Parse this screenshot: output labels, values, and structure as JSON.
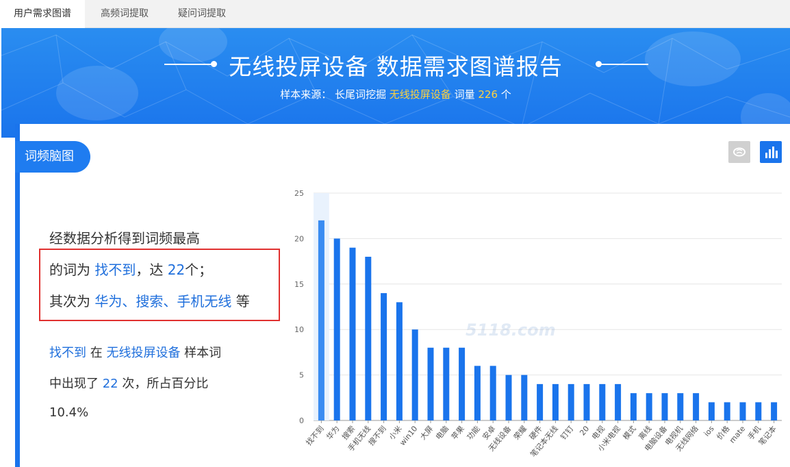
{
  "tabs": [
    "用户需求图谱",
    "高频词提取",
    "疑问词提取"
  ],
  "banner": {
    "title": "无线投屏设备 数据需求图谱报告",
    "sub_prefix": "样本来源：",
    "sub_source": "长尾词挖掘",
    "sub_keyword": "无线投屏设备",
    "sub_count_label": "词量",
    "sub_count": "226",
    "sub_unit": "个"
  },
  "card": {
    "label": "词频脑图",
    "brain_icon": "brain-icon",
    "bar_icon": "bar-chart-icon"
  },
  "analysis": {
    "line1": "经数据分析得到词频最高",
    "line2_pre": "的词为 ",
    "line2_word": "找不到",
    "line2_mid": "，达 ",
    "line2_num": "22",
    "line2_post": "个；",
    "line3_pre": "其次为 ",
    "line3_words": "华为、搜索、手机无线",
    "line3_post": " 等"
  },
  "stat": {
    "word": "找不到",
    "in_text": " 在 ",
    "keyword": "无线投屏设备",
    "sample_text": " 样本词",
    "appear_text": "中出现了 ",
    "count": "22",
    "count_post": " 次，所占百分比",
    "percent": "10.4%"
  },
  "watermark": "5118.com",
  "colors": {
    "accent": "#1a74ec",
    "bar": "#1a74ec",
    "highlight_box": "#e0302f",
    "sub_highlight": "#ffd23f"
  },
  "chart_data": {
    "type": "bar",
    "categories": [
      "找不到",
      "华为",
      "搜索",
      "手机无线",
      "搜不到",
      "小米",
      "win10",
      "大屏",
      "电脑",
      "苹果",
      "功能",
      "安卓",
      "无线设备",
      "荣耀",
      "硬件",
      "笔记本无线",
      "钉钉",
      "20",
      "电视",
      "小米电视",
      "模式",
      "离线",
      "电脑设备",
      "电视机",
      "无线网络",
      "ios",
      "价格",
      "mate",
      "手机",
      "笔记本"
    ],
    "values": [
      22,
      20,
      19,
      18,
      14,
      13,
      10,
      8,
      8,
      8,
      6,
      6,
      5,
      5,
      4,
      4,
      4,
      4,
      4,
      4,
      3,
      3,
      3,
      3,
      3,
      2,
      2,
      2,
      2,
      2
    ],
    "ylim": [
      0,
      25
    ],
    "yticks": [
      0,
      5,
      10,
      15,
      20,
      25
    ],
    "grid": true,
    "highlight_index": 0
  }
}
